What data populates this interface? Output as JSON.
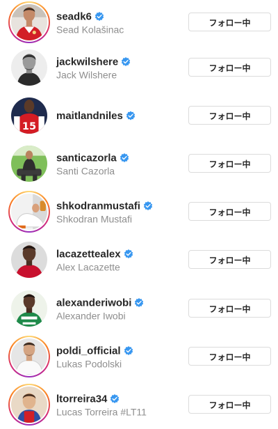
{
  "accounts": [
    {
      "username": "seadk6",
      "full_name": "Sead Kolašinac",
      "verified": true,
      "button_label": "フォロー中",
      "avatar": "red-kit-player-photo",
      "story_ring": true
    },
    {
      "username": "jackwilshere",
      "full_name": "Jack Wilshere",
      "verified": true,
      "button_label": "フォロー中",
      "avatar": "grayscale-portrait-photo",
      "story_ring": false
    },
    {
      "username": "maitlandniles",
      "full_name": "",
      "verified": true,
      "button_label": "フォロー中",
      "avatar": "red-jersey-number-15-photo",
      "story_ring": false
    },
    {
      "username": "santicazorla",
      "full_name": "Santi Cazorla",
      "verified": true,
      "button_label": "フォロー中",
      "avatar": "seated-player-green-field-photo",
      "story_ring": false
    },
    {
      "username": "shkodranmustafi",
      "full_name": "Shkodran Mustafi",
      "verified": true,
      "button_label": "フォロー中",
      "avatar": "seated-white-kit-photo",
      "story_ring": true
    },
    {
      "username": "lacazettealex",
      "full_name": "Alex Lacazette",
      "verified": true,
      "button_label": "フォロー中",
      "avatar": "portrait-red-shirt-photo",
      "story_ring": false
    },
    {
      "username": "alexanderiwobi",
      "full_name": "Alexander Iwobi",
      "verified": true,
      "button_label": "フォロー中",
      "avatar": "green-jersey-photo",
      "story_ring": false
    },
    {
      "username": "poldi_official",
      "full_name": "Lukas Podolski",
      "verified": true,
      "button_label": "フォロー中",
      "avatar": "white-shirt-portrait-photo",
      "story_ring": true
    },
    {
      "username": "ltorreira34",
      "full_name": "Lucas Torreira #LT11",
      "verified": true,
      "button_label": "フォロー中",
      "avatar": "child-blue-red-kit-photo",
      "story_ring": true
    }
  ],
  "icons": {
    "verified": "verified-badge-icon"
  },
  "colors": {
    "verified_badge": "#3897f0",
    "story_ring_start": "#feda75",
    "story_ring_end": "#962fbf",
    "secondary_text": "#8e8e8e",
    "button_border": "#dbdbdb"
  }
}
